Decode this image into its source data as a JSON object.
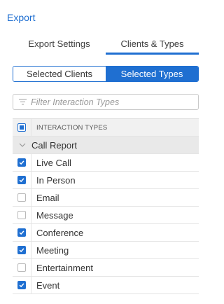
{
  "header": {
    "title": "Export"
  },
  "tabs": [
    {
      "label": "Export Settings",
      "active": false
    },
    {
      "label": "Clients & Types",
      "active": true
    }
  ],
  "segment": [
    {
      "label": "Selected Clients",
      "active": false
    },
    {
      "label": "Selected Types",
      "active": true
    }
  ],
  "filter": {
    "placeholder": "Filter Interaction Types",
    "value": "",
    "icon": "filter-icon"
  },
  "table": {
    "header": "INTERACTION TYPES",
    "group": {
      "label": "Call Report",
      "icon": "chevron-down-icon"
    },
    "items": [
      {
        "label": "Live Call",
        "checked": true
      },
      {
        "label": "In Person",
        "checked": true
      },
      {
        "label": "Email",
        "checked": false
      },
      {
        "label": "Message",
        "checked": false
      },
      {
        "label": "Conference",
        "checked": true
      },
      {
        "label": "Meeting",
        "checked": true
      },
      {
        "label": "Entertainment",
        "checked": false
      },
      {
        "label": "Event",
        "checked": true
      }
    ]
  },
  "colors": {
    "accent": "#1f6fd1",
    "border": "#e4e4e4",
    "group_bg": "#e9e9e9",
    "header_bg": "#f1f1f1"
  }
}
